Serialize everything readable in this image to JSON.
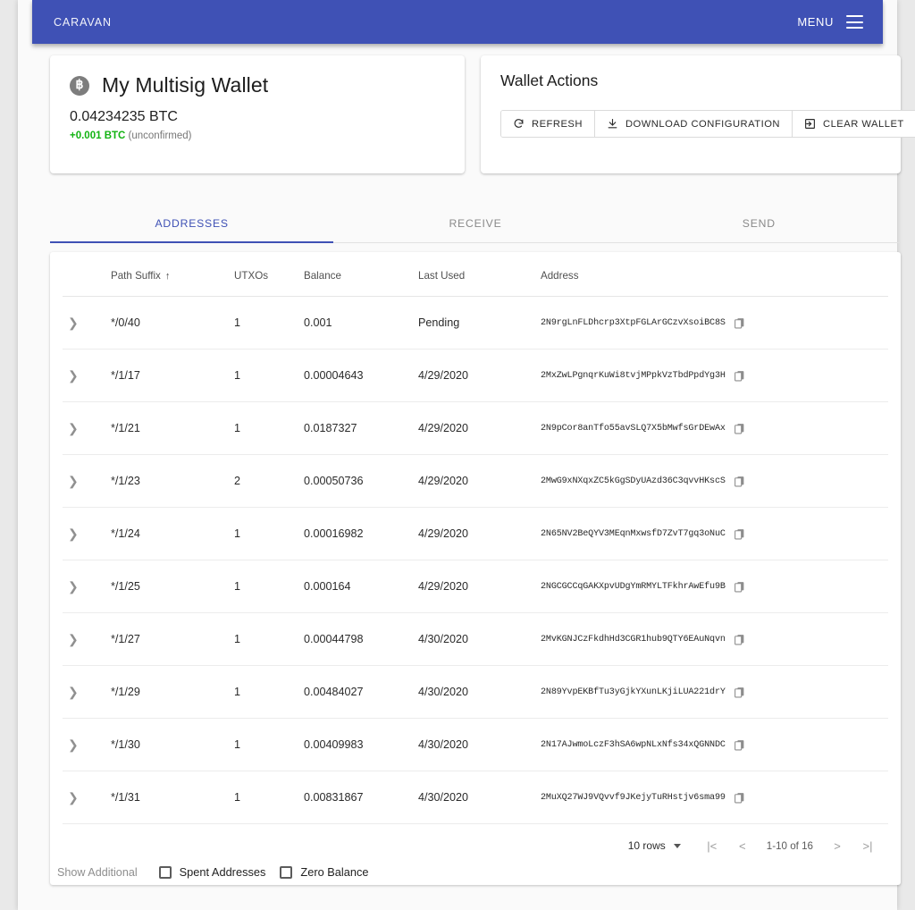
{
  "appbar": {
    "brand": "CARAVAN",
    "menu_label": "MENU",
    "menu_icon": "hamburger-icon",
    "background": "#3f51b5"
  },
  "wallet": {
    "icon": "bitcoin-icon",
    "name": "My Multisig Wallet",
    "balance": "0.04234235 BTC",
    "pending_amount": "+0.001 BTC",
    "pending_label": "(unconfirmed)",
    "pending_color": "#12b312"
  },
  "wallet_actions": {
    "title": "Wallet Actions",
    "buttons": [
      {
        "label": "REFRESH",
        "icon": "refresh-icon"
      },
      {
        "label": "DOWNLOAD CONFIGURATION",
        "icon": "download-icon"
      },
      {
        "label": "CLEAR WALLET",
        "icon": "logout-icon"
      }
    ]
  },
  "tabs": {
    "active_index": 0,
    "items": [
      {
        "label": "ADDRESSES"
      },
      {
        "label": "RECEIVE"
      },
      {
        "label": "SEND"
      }
    ],
    "accent": "#3f51b5"
  },
  "table": {
    "columns": [
      {
        "label": ""
      },
      {
        "label": "Path Suffix",
        "sort": "↑"
      },
      {
        "label": "UTXOs"
      },
      {
        "label": "Balance"
      },
      {
        "label": "Last Used"
      },
      {
        "label": "Address"
      }
    ],
    "rows": [
      {
        "path": "*/0/40",
        "utxos": "1",
        "balance": "0.001",
        "last_used": "Pending",
        "address": "2N9rgLnFLDhcrp3XtpFGLArGCzvXsoiBC8S"
      },
      {
        "path": "*/1/17",
        "utxos": "1",
        "balance": "0.00004643",
        "last_used": "4/29/2020",
        "address": "2MxZwLPgnqrKuWi8tvjMPpkVzTbdPpdYg3H"
      },
      {
        "path": "*/1/21",
        "utxos": "1",
        "balance": "0.0187327",
        "last_used": "4/29/2020",
        "address": "2N9pCor8anTfo55avSLQ7X5bMwfsGrDEwAx"
      },
      {
        "path": "*/1/23",
        "utxos": "2",
        "balance": "0.00050736",
        "last_used": "4/29/2020",
        "address": "2MwG9xNXqxZC5kGgSDyUAzd36C3qvvHKscS"
      },
      {
        "path": "*/1/24",
        "utxos": "1",
        "balance": "0.00016982",
        "last_used": "4/29/2020",
        "address": "2N65NV2BeQYV3MEqnMxwsfD7ZvT7gq3oNuC"
      },
      {
        "path": "*/1/25",
        "utxos": "1",
        "balance": "0.000164",
        "last_used": "4/29/2020",
        "address": "2NGCGCCqGAKXpvUDgYmRMYLTFkhrAwEfu9B"
      },
      {
        "path": "*/1/27",
        "utxos": "1",
        "balance": "0.00044798",
        "last_used": "4/30/2020",
        "address": "2MvKGNJCzFkdhHd3CGR1hub9QTY6EAuNqvn"
      },
      {
        "path": "*/1/29",
        "utxos": "1",
        "balance": "0.00484027",
        "last_used": "4/30/2020",
        "address": "2N89YvpEKBfTu3yGjkYXunLKjiLUA221drY"
      },
      {
        "path": "*/1/30",
        "utxos": "1",
        "balance": "0.00409983",
        "last_used": "4/30/2020",
        "address": "2N17AJwmoLczF3hSA6wpNLxNfs34xQGNNDC"
      },
      {
        "path": "*/1/31",
        "utxos": "1",
        "balance": "0.00831867",
        "last_used": "4/30/2020",
        "address": "2MuXQ27WJ9VQvvf9JKejyTuRHstjv6sma99"
      }
    ],
    "row_expand_icon": "chevron-right-icon",
    "copy_icon": "copy-icon"
  },
  "pagination": {
    "rows_per_page": "10 rows",
    "range": "1-10 of 16",
    "first_label": "|<",
    "prev_label": "<",
    "next_label": ">",
    "last_label": ">|"
  },
  "show_additional": {
    "label": "Show Additional",
    "options": [
      {
        "label": "Spent Addresses",
        "checked": false
      },
      {
        "label": "Zero Balance",
        "checked": false
      }
    ]
  }
}
